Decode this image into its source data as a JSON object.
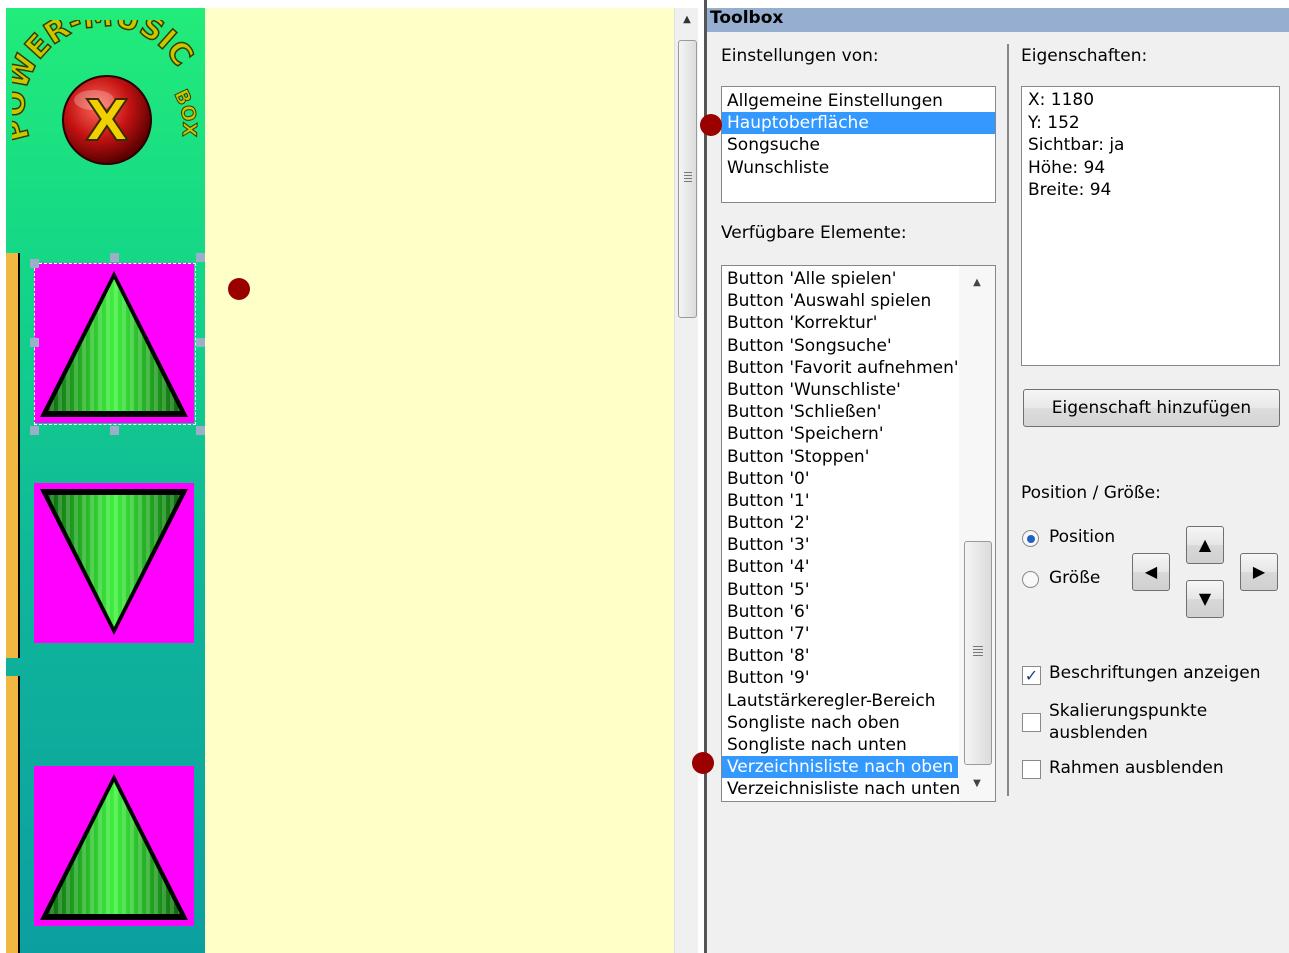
{
  "canvas": {
    "logo_text_top": "POWER-MUSIC",
    "logo_text_side": "BOX",
    "logo_letter": "X",
    "colors": {
      "canvas_bg": "#ffffc8",
      "skin_gradient_top": "#22ec7a",
      "skin_gradient_bottom": "#0c9fa0",
      "button_bg": "#ff00ff",
      "triangle_green": "#1fc41f",
      "marker": "#9b0000",
      "selection_bg": "#3399ff"
    }
  },
  "toolbox": {
    "title": "Toolbox",
    "settings_of_label": "Einstellungen von:",
    "settings_of_items": [
      {
        "label": "Allgemeine Einstellungen",
        "selected": false
      },
      {
        "label": "Hauptoberfläche",
        "selected": true
      },
      {
        "label": "Songsuche",
        "selected": false
      },
      {
        "label": "Wunschliste",
        "selected": false
      }
    ],
    "available_label": "Verfügbare Elemente:",
    "available_items": [
      {
        "label": "Button 'Alle spielen'",
        "selected": false
      },
      {
        "label": "Button 'Auswahl spielen",
        "selected": false
      },
      {
        "label": "Button 'Korrektur'",
        "selected": false
      },
      {
        "label": "Button 'Songsuche'",
        "selected": false
      },
      {
        "label": "Button 'Favorit aufnehmen'",
        "selected": false
      },
      {
        "label": "Button 'Wunschliste'",
        "selected": false
      },
      {
        "label": "Button 'Schließen'",
        "selected": false
      },
      {
        "label": "Button 'Speichern'",
        "selected": false
      },
      {
        "label": "Button 'Stoppen'",
        "selected": false
      },
      {
        "label": "Button '0'",
        "selected": false
      },
      {
        "label": "Button '1'",
        "selected": false
      },
      {
        "label": "Button '2'",
        "selected": false
      },
      {
        "label": "Button '3'",
        "selected": false
      },
      {
        "label": "Button '4'",
        "selected": false
      },
      {
        "label": "Button '5'",
        "selected": false
      },
      {
        "label": "Button '6'",
        "selected": false
      },
      {
        "label": "Button '7'",
        "selected": false
      },
      {
        "label": "Button '8'",
        "selected": false
      },
      {
        "label": "Button '9'",
        "selected": false
      },
      {
        "label": "Lautstärkeregler-Bereich",
        "selected": false
      },
      {
        "label": "Songliste nach oben",
        "selected": false
      },
      {
        "label": "Songliste nach unten",
        "selected": false
      },
      {
        "label": "Verzeichnisliste nach oben",
        "selected": true
      },
      {
        "label": "Verzeichnisliste nach unten",
        "selected": false
      }
    ],
    "properties_label": "Eigenschaften:",
    "properties": [
      "X: 1180",
      "Y: 152",
      "Sichtbar: ja",
      "Höhe: 94",
      "Breite: 94"
    ],
    "add_property_button": "Eigenschaft hinzufügen",
    "position_size_label": "Position / Größe:",
    "radio_position": {
      "label": "Position",
      "checked": true
    },
    "radio_size": {
      "label": "Größe",
      "checked": false
    },
    "arrow_up": "▲",
    "arrow_left": "◀",
    "arrow_right": "▶",
    "arrow_down": "▼",
    "check_show_labels": {
      "label": "Beschriftungen anzeigen",
      "checked": true
    },
    "check_hide_scale_points": {
      "label": "Skalierungspunkte ausblenden",
      "checked": false
    },
    "check_hide_frame": {
      "label": "Rahmen ausblenden",
      "checked": false
    }
  }
}
